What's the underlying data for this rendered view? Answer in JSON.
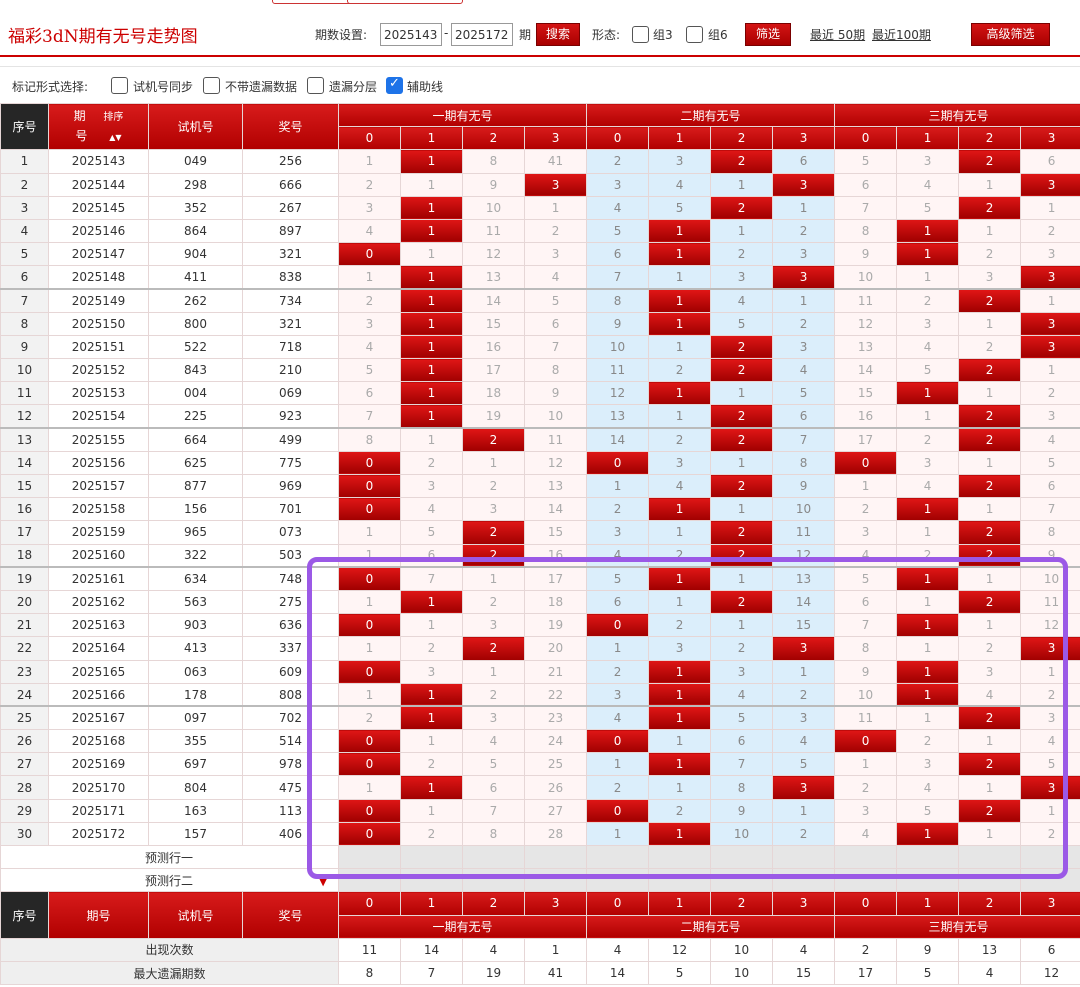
{
  "header": {
    "title": "福彩3dN期有无号走势图",
    "period_label": "期数设置:",
    "period_from": "2025143",
    "period_sep": "-",
    "period_to": "2025172",
    "period_suffix": "期",
    "search_label": "搜索",
    "form_label": "形态:",
    "group3_label": "组3",
    "group6_label": "组6",
    "filter_label": "筛选",
    "recent50_label": "最近 50期",
    "recent100_label": "最近100期",
    "advanced_label": "高级筛选"
  },
  "markers": {
    "label": "标记形式选择:",
    "options": [
      {
        "label": "试机号同步",
        "checked": false
      },
      {
        "label": "不带遗漏数据",
        "checked": false
      },
      {
        "label": "遗漏分层",
        "checked": false
      },
      {
        "label": "辅助线",
        "checked": true
      }
    ]
  },
  "table": {
    "col_seq": "序号",
    "col_period_top": "期",
    "col_period_bottom": "号",
    "col_sort": "排序",
    "col_sort_arrows": "▲▼",
    "col_test": "试机号",
    "col_prize": "奖号",
    "col_period_footer": "期号",
    "groups": [
      "一期有无号",
      "二期有无号",
      "三期有无号"
    ],
    "digits": [
      "0",
      "1",
      "2",
      "3"
    ],
    "rows": [
      {
        "seq": "1",
        "period": "2025143",
        "test": "049",
        "prize": "256",
        "cells": [
          1,
          "*1",
          8,
          41,
          2,
          3,
          "*2",
          6,
          5,
          3,
          "*2",
          6
        ]
      },
      {
        "seq": "2",
        "period": "2025144",
        "test": "298",
        "prize": "666",
        "cells": [
          2,
          1,
          9,
          "*3",
          3,
          4,
          1,
          "*3",
          6,
          4,
          1,
          "*3"
        ]
      },
      {
        "seq": "3",
        "period": "2025145",
        "test": "352",
        "prize": "267",
        "cells": [
          3,
          "*1",
          10,
          1,
          4,
          5,
          "*2",
          1,
          7,
          5,
          "*2",
          1
        ]
      },
      {
        "seq": "4",
        "period": "2025146",
        "test": "864",
        "prize": "897",
        "cells": [
          4,
          "*1",
          11,
          2,
          5,
          "*1",
          1,
          2,
          8,
          "*1",
          1,
          2
        ]
      },
      {
        "seq": "5",
        "period": "2025147",
        "test": "904",
        "prize": "321",
        "cells": [
          "*0",
          1,
          12,
          3,
          6,
          "*1",
          2,
          3,
          9,
          "*1",
          2,
          3
        ]
      },
      {
        "seq": "6",
        "period": "2025148",
        "test": "411",
        "prize": "838",
        "cells": [
          1,
          "*1",
          13,
          4,
          7,
          1,
          3,
          "*3",
          10,
          1,
          3,
          "*3"
        ]
      },
      {
        "seq": "7",
        "period": "2025149",
        "test": "262",
        "prize": "734",
        "cells": [
          2,
          "*1",
          14,
          5,
          8,
          "*1",
          4,
          1,
          11,
          2,
          "*2",
          1
        ]
      },
      {
        "seq": "8",
        "period": "2025150",
        "test": "800",
        "prize": "321",
        "cells": [
          3,
          "*1",
          15,
          6,
          9,
          "*1",
          5,
          2,
          12,
          3,
          1,
          "*3"
        ]
      },
      {
        "seq": "9",
        "period": "2025151",
        "test": "522",
        "prize": "718",
        "cells": [
          4,
          "*1",
          16,
          7,
          10,
          1,
          "*2",
          3,
          13,
          4,
          2,
          "*3"
        ]
      },
      {
        "seq": "10",
        "period": "2025152",
        "test": "843",
        "prize": "210",
        "cells": [
          5,
          "*1",
          17,
          8,
          11,
          2,
          "*2",
          4,
          14,
          5,
          "*2",
          1
        ]
      },
      {
        "seq": "11",
        "period": "2025153",
        "test": "004",
        "prize": "069",
        "cells": [
          6,
          "*1",
          18,
          9,
          12,
          "*1",
          1,
          5,
          15,
          "*1",
          1,
          2
        ]
      },
      {
        "seq": "12",
        "period": "2025154",
        "test": "225",
        "prize": "923",
        "cells": [
          7,
          "*1",
          19,
          10,
          13,
          1,
          "*2",
          6,
          16,
          1,
          "*2",
          3
        ]
      },
      {
        "seq": "13",
        "period": "2025155",
        "test": "664",
        "prize": "499",
        "cells": [
          8,
          1,
          "*2",
          11,
          14,
          2,
          "*2",
          7,
          17,
          2,
          "*2",
          4
        ]
      },
      {
        "seq": "14",
        "period": "2025156",
        "test": "625",
        "prize": "775",
        "cells": [
          "*0",
          2,
          1,
          12,
          "*0",
          3,
          1,
          8,
          "*0",
          3,
          1,
          5
        ]
      },
      {
        "seq": "15",
        "period": "2025157",
        "test": "877",
        "prize": "969",
        "cells": [
          "*0",
          3,
          2,
          13,
          1,
          4,
          "*2",
          9,
          1,
          4,
          "*2",
          6
        ]
      },
      {
        "seq": "16",
        "period": "2025158",
        "test": "156",
        "prize": "701",
        "cells": [
          "*0",
          4,
          3,
          14,
          2,
          "*1",
          1,
          10,
          2,
          "*1",
          1,
          7
        ]
      },
      {
        "seq": "17",
        "period": "2025159",
        "test": "965",
        "prize": "073",
        "cells": [
          1,
          5,
          "*2",
          15,
          3,
          1,
          "*2",
          11,
          3,
          1,
          "*2",
          8
        ]
      },
      {
        "seq": "18",
        "period": "2025160",
        "test": "322",
        "prize": "503",
        "cells": [
          1,
          6,
          "*2",
          16,
          4,
          2,
          "*2",
          12,
          4,
          2,
          "*2",
          9
        ]
      },
      {
        "seq": "19",
        "period": "2025161",
        "test": "634",
        "prize": "748",
        "cells": [
          "*0",
          7,
          1,
          17,
          5,
          "*1",
          1,
          13,
          5,
          "*1",
          1,
          10
        ]
      },
      {
        "seq": "20",
        "period": "2025162",
        "test": "563",
        "prize": "275",
        "cells": [
          1,
          "*1",
          2,
          18,
          6,
          1,
          "*2",
          14,
          6,
          1,
          "*2",
          11
        ]
      },
      {
        "seq": "21",
        "period": "2025163",
        "test": "903",
        "prize": "636",
        "cells": [
          "*0",
          1,
          3,
          19,
          "*0",
          2,
          1,
          15,
          7,
          "*1",
          1,
          12
        ]
      },
      {
        "seq": "22",
        "period": "2025164",
        "test": "413",
        "prize": "337",
        "cells": [
          1,
          2,
          "*2",
          20,
          1,
          3,
          2,
          "*3",
          8,
          1,
          2,
          "*3"
        ]
      },
      {
        "seq": "23",
        "period": "2025165",
        "test": "063",
        "prize": "609",
        "cells": [
          "*0",
          3,
          1,
          21,
          2,
          "*1",
          3,
          1,
          9,
          "*1",
          3,
          1
        ]
      },
      {
        "seq": "24",
        "period": "2025166",
        "test": "178",
        "prize": "808",
        "cells": [
          1,
          "*1",
          2,
          22,
          3,
          "*1",
          4,
          2,
          10,
          "*1",
          4,
          2
        ]
      },
      {
        "seq": "25",
        "period": "2025167",
        "test": "097",
        "prize": "702",
        "cells": [
          2,
          "*1",
          3,
          23,
          4,
          "*1",
          5,
          3,
          11,
          1,
          "*2",
          3
        ]
      },
      {
        "seq": "26",
        "period": "2025168",
        "test": "355",
        "prize": "514",
        "cells": [
          "*0",
          1,
          4,
          24,
          "*0",
          1,
          6,
          4,
          "*0",
          2,
          1,
          4
        ]
      },
      {
        "seq": "27",
        "period": "2025169",
        "test": "697",
        "prize": "978",
        "cells": [
          "*0",
          2,
          5,
          25,
          1,
          "*1",
          7,
          5,
          1,
          3,
          "*2",
          5
        ]
      },
      {
        "seq": "28",
        "period": "2025170",
        "test": "804",
        "prize": "475",
        "cells": [
          1,
          "*1",
          6,
          26,
          2,
          1,
          8,
          "*3",
          2,
          4,
          1,
          "*3"
        ]
      },
      {
        "seq": "29",
        "period": "2025171",
        "test": "163",
        "prize": "113",
        "cells": [
          "*0",
          1,
          7,
          27,
          "*0",
          2,
          9,
          1,
          3,
          5,
          "*2",
          1
        ]
      },
      {
        "seq": "30",
        "period": "2025172",
        "test": "157",
        "prize": "406",
        "cells": [
          "*0",
          2,
          8,
          28,
          1,
          "*1",
          10,
          2,
          4,
          "*1",
          1,
          2
        ]
      }
    ],
    "predict1_label": "预测行一",
    "predict2_label": "预测行二",
    "stats": [
      {
        "label": "出现次数",
        "values": [
          "11",
          "14",
          "4",
          "1",
          "4",
          "12",
          "10",
          "4",
          "2",
          "9",
          "13",
          "6"
        ]
      },
      {
        "label": "最大遗漏期数",
        "values": [
          "8",
          "7",
          "19",
          "41",
          "14",
          "5",
          "10",
          "15",
          "17",
          "5",
          "4",
          "12"
        ]
      }
    ]
  }
}
